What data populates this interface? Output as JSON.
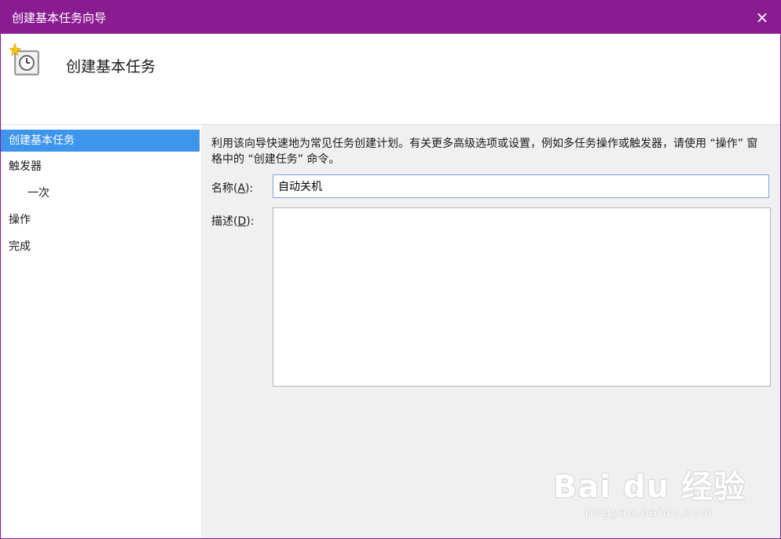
{
  "window": {
    "title": "创建基本任务向导",
    "close_icon": "×"
  },
  "header": {
    "title": "创建基本任务",
    "icon": "task-clock-icon"
  },
  "sidebar": {
    "items": [
      {
        "label": "创建基本任务",
        "active": true
      },
      {
        "label": "触发器",
        "active": false
      },
      {
        "label": "一次",
        "active": false
      },
      {
        "label": "操作",
        "active": false
      },
      {
        "label": "完成",
        "active": false
      }
    ]
  },
  "main": {
    "description": "利用该向导快速地为常见任务创建计划。有关更多高级选项或设置，例如多任务操作或触发器，请使用 “操作” 窗格中的 “创建任务” 命令。",
    "name_label": "名称(",
    "name_key": "A",
    "name_label_end": "):",
    "name_value": "自动关机",
    "desc_label": "描述(",
    "desc_key": "D",
    "desc_label_end": "):",
    "desc_value": ""
  },
  "watermark": {
    "brand": "Bai du 经验",
    "url": "jingyan.baidu.com"
  },
  "colors": {
    "titlebar": "#8a1c92",
    "selection": "#3e96ec"
  }
}
